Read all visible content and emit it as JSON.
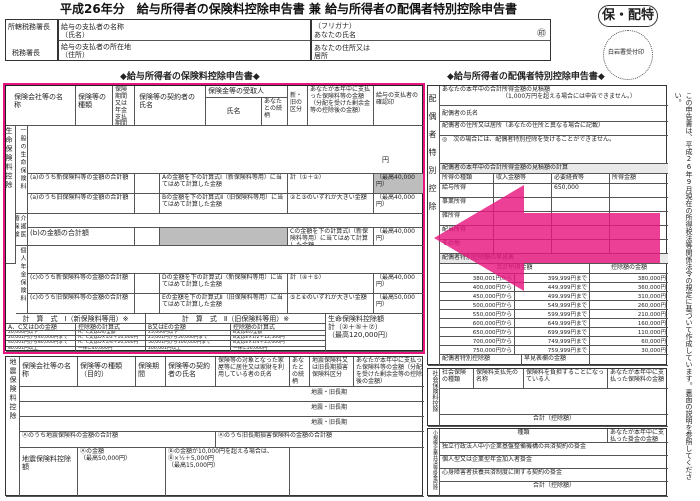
{
  "header": {
    "title": "平成26年分　給与所得者の保険料控除申告書 兼 給与所得者の配偶者特別控除申告書",
    "badge": "保・配特",
    "stamp_text": "白岩署受付印",
    "seal": "㊞",
    "office_label": "所轄税務署長",
    "tax_office_label": "税務署長",
    "payer_name_label": "給与の支払者の名称（氏名）",
    "payer_addr_label": "給与の支払者の所在地（住所）",
    "furigana_label": "（フリガナ）",
    "your_name_label": "あなたの氏名",
    "your_addr_label": "あなたの住所又は居所"
  },
  "insurance": {
    "section_title": "◆給与所得者の保険料控除申告書◆",
    "col_company": "保険会社等の名称",
    "col_type": "保険等の種類",
    "col_period": "保険期間又は年金支払期間",
    "col_contractor": "保険等の契約者の氏名",
    "col_recipient": "保険金等の受取人",
    "col_name": "氏名",
    "col_relation": "あなたとの続柄",
    "col_new_old": "新・旧の区分",
    "col_paid": "あなたが本年中に支払った保険料等の金額（分配を受けた剰余金等の控除後の金額）",
    "col_confirm": "給与の支払者の確認印",
    "yen": "円",
    "group_label": "生命保険料控除",
    "general_label": "一般の生命保険料",
    "care_label": "介護医療保険料",
    "pension_label": "個人年金保険料",
    "new_old_label": "新・旧",
    "row_a": "(a)のうち新保険料等の金額の合計額",
    "row_b": "(a)のうち旧保険料等の金額の合計額",
    "row_c": "(b)の金額の合計額",
    "row_d": "(c)のうち新保険料等の金額の合計額",
    "row_e": "(c)のうち旧保険料等の金額の合計額",
    "calc_a": "Aの金額を下の計算式Ⅰ（新保険料等用）に当てはめて計算した金額",
    "calc_b": "Bの金額を下の計算式Ⅱ（旧保険料等用）に当てはめて計算した金額",
    "calc_c": "Cの金額を下の計算式Ⅰ（新保険料等用）に当てはめて計算した金額",
    "calc_d": "Dの金額を下の計算式Ⅰ（新保険料等用）に当てはめて計算した金額",
    "calc_e": "Eの金額を下の計算式Ⅱ（旧保険料等用）に当てはめて計算した金額",
    "max_40000": "（最高40,000円）",
    "max_50000": "（最高50,000円）",
    "max_120000": "（最高120,000円）",
    "sum_12": "計（①＋②）",
    "sum_45": "計（④＋⑤）",
    "choose": "②と③のいずれか大きい金額",
    "choose2": "⑤と⑥のいずれか大きい金額",
    "formula1_title": "計　算　式　Ⅰ（新保険料等用）※",
    "formula2_title": "計　算　式　Ⅱ（旧保険料等用）※",
    "life_total_title": "生命保険料控除額",
    "life_total_formula": "計（②＋⑤＋⑦）",
    "f_ab": "A、C又はDの金額",
    "f_calc": "控除額の計算式",
    "f_be": "B又はEの金額",
    "f1_rows": [
      [
        "20,000円以下",
        "A、C又はDの全額"
      ],
      [
        "20,001円から40,000円まで",
        "A、C又はD×1/2＋10,000円"
      ],
      [
        "40,001円から80,000円まで",
        "A、C又はD×1/4＋20,000円"
      ],
      [
        "80,001円以上",
        "一律に40,000円"
      ]
    ],
    "f2_rows": [
      [
        "25,000円以下",
        "B又はEの全額"
      ],
      [
        "25,001円から50,000円まで",
        "B又はE×1/2＋12,500円"
      ],
      [
        "50,001円から100,000円まで",
        "B又はE×1/4＋25,000円"
      ],
      [
        "100,001円以上",
        "一律に50,000円"
      ]
    ],
    "circles": [
      "①",
      "②",
      "③",
      "④",
      "⑤",
      "⑥",
      "⑦",
      "⑧"
    ]
  },
  "quake": {
    "group_label": "地震保険料控除",
    "col_company": "保険会社等の名称",
    "col_target": "保険等の種類（目的）",
    "col_period": "保険期間",
    "col_contractor": "保険等の契約者の氏名",
    "col_insured": "保険等の対象となった家屋等に居住又は家財を利用している者の氏名",
    "col_relation": "あなたとの続柄",
    "col_kind": "地震保険料又は旧長期損害保険料区分",
    "col_paid": "あなたが本年中に支払った保険料等の金額（分配を受けた剰余金等の控除後の金額）",
    "kind_value": "地震・旧長期",
    "sum_a": "Ⓐのうち地震保険料の金額の合計額",
    "sum_b": "Ⓐのうち旧長期損害保険料の金額の合計額",
    "deduction_label": "地震保険料控除額",
    "deduction_formula_a": "Ⓐの金額",
    "deduction_formula_b": "Ⓑの金額が10,000円を超える場合は、Ⓑ×½＋5,000円",
    "max_15000": "（最高15,000円）",
    "max_50000": "（最高50,000円）"
  },
  "spouse": {
    "section_title": "◆給与所得者の配偶者特別控除申告書◆",
    "expected_income": "あなたの本年中の合計所得金額の見積額",
    "income_note": "（1,000万円を超える場合には申告できません。）",
    "spouse_name": "配偶者の氏名",
    "spouse_addr": "配偶者の住所又は居所（あなたの住所と異なる場合に記載）",
    "instructions": "◎　次の場合には、配偶者特別控除を受けることができません。",
    "estimate_title": "配偶者の本年中の合計所得金額の見積額の計算",
    "col_kind": "所得の種類",
    "col_income": "収入金額等",
    "col_expense": "必要経費等",
    "col_amount": "所得金額",
    "rows": [
      "給与所得",
      "事業所得",
      "雑所得",
      "配当所得",
      "その他"
    ],
    "standard": "650,000",
    "calc_title": "配偶者特別控除額の早見表",
    "table_head1": "合計所得金額",
    "table_head2": "控除額の金額",
    "quick_rows": [
      [
        "380,001円から",
        "399,999円まで",
        "380,000円"
      ],
      [
        "400,000円から",
        "449,999円まで",
        "360,000円"
      ],
      [
        "450,000円から",
        "499,999円まで",
        "310,000円"
      ],
      [
        "500,000円から",
        "549,999円まで",
        "260,000円"
      ],
      [
        "550,000円から",
        "599,999円まで",
        "210,000円"
      ],
      [
        "600,000円から",
        "649,999円まで",
        "160,000円"
      ],
      [
        "650,000円から",
        "699,999円まで",
        "110,000円"
      ],
      [
        "700,000円から",
        "749,999円まで",
        "60,000円"
      ],
      [
        "750,000円から",
        "759,999円まで",
        "30,000円"
      ]
    ],
    "deduction_label": "配偶者特別控除額",
    "quick_ref": "早見表欄の金額",
    "side_labels": [
      "配",
      "偶",
      "者",
      "特",
      "別",
      "控",
      "除"
    ],
    "total_label": "合計",
    "yen": "円",
    "circle_a": "Ⓐ",
    "circle_b": "Ⓑ"
  },
  "social": {
    "group_label": "社会保険料控除",
    "col_type": "社会保険の種類",
    "col_payee": "保険料支払先の名称",
    "col_payer": "保険料を負担することになっている人",
    "col_name": "氏名",
    "col_relation": "あなたとの続柄",
    "col_paid": "あなたが本年中に支払った保険料の金額",
    "total": "合計（控除額）"
  },
  "small_biz": {
    "group_label": "小規模企業共済等掛金控除",
    "col_kind": "種類",
    "col_paid": "あなたが本年中に支払った掛金の金額",
    "rows": [
      "独立行政法人中小企業基盤整備機構の共済契約の掛金",
      "個人型又は企業型年金加入者掛金",
      "心身障害者扶養共済制度に関する契約の掛金"
    ],
    "total": "合計（控除額）"
  },
  "side_note": "この申告書は、平成26年9月現在の所得税法等関係法令の規定に基づいて作成しています。裏面の説明を参照してください。",
  "colors": {
    "highlight": "#e8157f",
    "arrow": "#e8157f",
    "shade": "#bdbdbd"
  }
}
